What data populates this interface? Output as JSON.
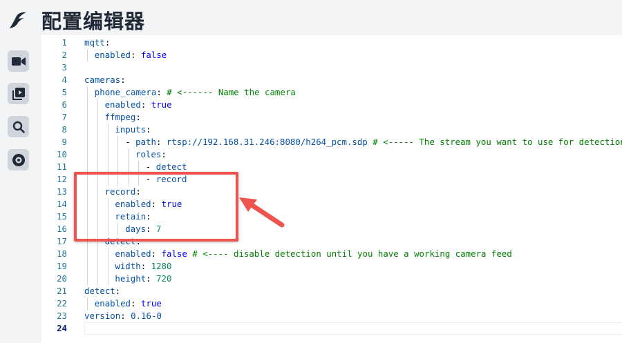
{
  "page": {
    "title": "配置编辑器"
  },
  "sidebar": {
    "icons": [
      {
        "name": "bird-logo-icon"
      },
      {
        "name": "video-camera-icon"
      },
      {
        "name": "recordings-icon"
      },
      {
        "name": "search-icon"
      },
      {
        "name": "settings-icon"
      }
    ]
  },
  "editor": {
    "current_line": 24,
    "lines": [
      {
        "no": "1",
        "indent": 0,
        "segments": [
          {
            "t": "k",
            "v": "mqtt"
          },
          {
            "t": "p",
            "v": ":"
          }
        ]
      },
      {
        "no": "2",
        "indent": 1,
        "segments": [
          {
            "t": "k",
            "v": "enabled"
          },
          {
            "t": "p",
            "v": ": "
          },
          {
            "t": "kw",
            "v": "false"
          }
        ]
      },
      {
        "no": "3",
        "indent": 0,
        "segments": []
      },
      {
        "no": "4",
        "indent": 0,
        "segments": [
          {
            "t": "k",
            "v": "cameras"
          },
          {
            "t": "p",
            "v": ":"
          }
        ]
      },
      {
        "no": "5",
        "indent": 1,
        "segments": [
          {
            "t": "k",
            "v": "phone_camera"
          },
          {
            "t": "p",
            "v": ": "
          },
          {
            "t": "c",
            "v": "# <------ Name the camera"
          }
        ]
      },
      {
        "no": "6",
        "indent": 2,
        "segments": [
          {
            "t": "k",
            "v": "enabled"
          },
          {
            "t": "p",
            "v": ": "
          },
          {
            "t": "kw",
            "v": "true"
          }
        ]
      },
      {
        "no": "7",
        "indent": 2,
        "segments": [
          {
            "t": "k",
            "v": "ffmpeg"
          },
          {
            "t": "p",
            "v": ":"
          }
        ]
      },
      {
        "no": "8",
        "indent": 3,
        "segments": [
          {
            "t": "k",
            "v": "inputs"
          },
          {
            "t": "p",
            "v": ":"
          }
        ]
      },
      {
        "no": "9",
        "indent": 4,
        "segments": [
          {
            "t": "p",
            "v": "- "
          },
          {
            "t": "k",
            "v": "path"
          },
          {
            "t": "p",
            "v": ": "
          },
          {
            "t": "s",
            "v": "rtsp://192.168.31.246:8080/h264_pcm.sdp"
          },
          {
            "t": "p",
            "v": " "
          },
          {
            "t": "c",
            "v": "# <----- The stream you want to use for detection"
          }
        ]
      },
      {
        "no": "10",
        "indent": 5,
        "segments": [
          {
            "t": "k",
            "v": "roles"
          },
          {
            "t": "p",
            "v": ":"
          }
        ]
      },
      {
        "no": "11",
        "indent": 6,
        "segments": [
          {
            "t": "p",
            "v": "- "
          },
          {
            "t": "s",
            "v": "detect"
          }
        ]
      },
      {
        "no": "12",
        "indent": 6,
        "segments": [
          {
            "t": "p",
            "v": "- "
          },
          {
            "t": "s",
            "v": "record"
          }
        ]
      },
      {
        "no": "13",
        "indent": 2,
        "segments": [
          {
            "t": "k",
            "v": "record"
          },
          {
            "t": "p",
            "v": ":"
          }
        ]
      },
      {
        "no": "14",
        "indent": 3,
        "segments": [
          {
            "t": "k",
            "v": "enabled"
          },
          {
            "t": "p",
            "v": ": "
          },
          {
            "t": "kw",
            "v": "true"
          }
        ]
      },
      {
        "no": "15",
        "indent": 3,
        "segments": [
          {
            "t": "k",
            "v": "retain"
          },
          {
            "t": "p",
            "v": ":"
          }
        ]
      },
      {
        "no": "16",
        "indent": 4,
        "segments": [
          {
            "t": "k",
            "v": "days"
          },
          {
            "t": "p",
            "v": ": "
          },
          {
            "t": "n",
            "v": "7"
          }
        ]
      },
      {
        "no": "17",
        "indent": 2,
        "segments": [
          {
            "t": "k",
            "v": "detect"
          },
          {
            "t": "p",
            "v": ":"
          }
        ]
      },
      {
        "no": "18",
        "indent": 3,
        "segments": [
          {
            "t": "k",
            "v": "enabled"
          },
          {
            "t": "p",
            "v": ": "
          },
          {
            "t": "kw",
            "v": "false"
          },
          {
            "t": "p",
            "v": " "
          },
          {
            "t": "c",
            "v": "# <---- disable detection until you have a working camera feed"
          }
        ]
      },
      {
        "no": "19",
        "indent": 3,
        "segments": [
          {
            "t": "k",
            "v": "width"
          },
          {
            "t": "p",
            "v": ": "
          },
          {
            "t": "n",
            "v": "1280"
          }
        ]
      },
      {
        "no": "20",
        "indent": 3,
        "segments": [
          {
            "t": "k",
            "v": "height"
          },
          {
            "t": "p",
            "v": ": "
          },
          {
            "t": "n",
            "v": "720"
          }
        ]
      },
      {
        "no": "21",
        "indent": 0,
        "segments": [
          {
            "t": "k",
            "v": "detect"
          },
          {
            "t": "p",
            "v": ":"
          }
        ]
      },
      {
        "no": "22",
        "indent": 1,
        "segments": [
          {
            "t": "k",
            "v": "enabled"
          },
          {
            "t": "p",
            "v": ": "
          },
          {
            "t": "kw",
            "v": "true"
          }
        ]
      },
      {
        "no": "23",
        "indent": 0,
        "segments": [
          {
            "t": "k",
            "v": "version"
          },
          {
            "t": "p",
            "v": ": "
          },
          {
            "t": "s",
            "v": "0.16-0"
          }
        ]
      },
      {
        "no": "24",
        "indent": 0,
        "segments": []
      }
    ]
  },
  "annotation": {
    "color": "#ef5350",
    "highlight_lines": "13-16"
  }
}
